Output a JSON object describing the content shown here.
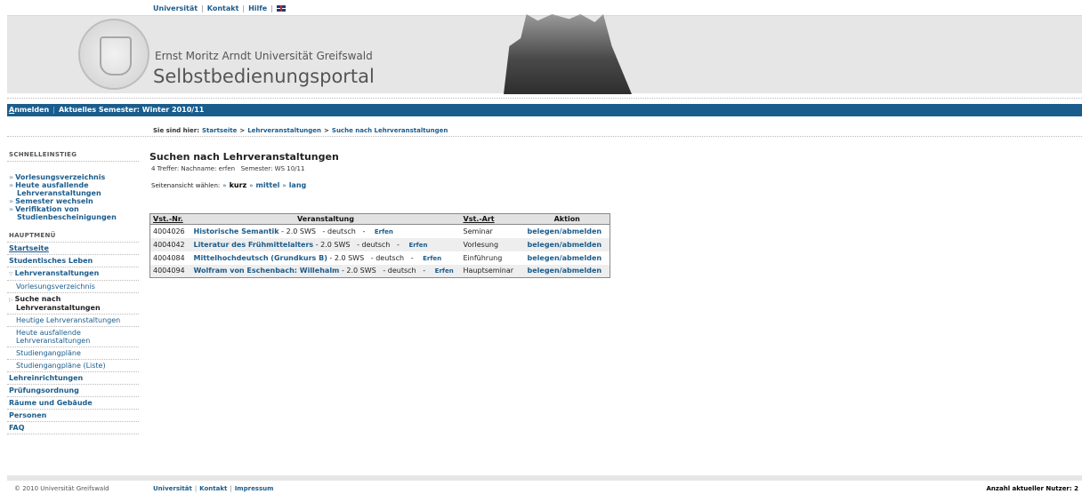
{
  "top_links": {
    "universitaet": "Universität",
    "kontakt": "Kontakt",
    "hilfe": "Hilfe"
  },
  "header": {
    "university": "Ernst Moritz Arndt Universität Greifswald",
    "portal": "Selbstbedienungsportal"
  },
  "navbar": {
    "login_first": "A",
    "login_rest": "nmelden",
    "semester": "Aktuelles Semester: Winter 2010/11"
  },
  "breadcrumb": {
    "prefix": "Sie sind hier:",
    "items": [
      "Startseite",
      "Lehrveranstaltungen",
      "Suche nach Lehrveranstaltungen"
    ],
    "sep": ">"
  },
  "sidebar": {
    "quick_title": "SCHNELLEINSTIEG",
    "quick": [
      {
        "line1": "Vorlesungsverzeichnis",
        "line2": ""
      },
      {
        "line1": "Heute ausfallende",
        "line2": "Lehrveranstaltungen"
      },
      {
        "line1": "Semester wechseln",
        "line2": ""
      },
      {
        "line1": "Verifikation von",
        "line2": "Studienbescheinigungen"
      }
    ],
    "main_title": "HAUPTMENÜ",
    "menu": {
      "startseite": "Startseite",
      "studentisches_leben": "Studentisches Leben",
      "lehrveranstaltungen": "Lehrveranstaltungen",
      "sub": [
        {
          "line1": "Vorlesungsverzeichnis",
          "line2": ""
        },
        {
          "line1": "Suche nach",
          "line2": "Lehrveranstaltungen"
        },
        {
          "line1": "Heutige Lehrveranstaltungen",
          "line2": ""
        },
        {
          "line1": "Heute ausfallende",
          "line2": "Lehrveranstaltungen"
        },
        {
          "line1": "Studiengangpläne",
          "line2": ""
        },
        {
          "line1": "Studiengangpläne (Liste)",
          "line2": ""
        }
      ],
      "lehreinrichtungen": "Lehreinrichtungen",
      "pruefungsordnung": "Prüfungsordnung",
      "raeume": "Räume und Gebäude",
      "personen": "Personen",
      "faq": "FAQ"
    }
  },
  "content": {
    "title": "Suchen nach Lehrveranstaltungen",
    "treffer": "4 Treffer: Nachname: erfen   Semester: WS 10/11",
    "view_label": "Seitenansicht wählen:",
    "view_kurz": "kurz",
    "view_mittel": "mittel",
    "view_lang": "lang",
    "table": {
      "headers": [
        "Vst.-Nr.",
        "Veranstaltung",
        "Vst.-Art",
        "Aktion"
      ],
      "rows": [
        {
          "nr": "4004026",
          "title": "Historische Semantik",
          "info": " - 2.0 SWS   - deutsch   - ",
          "person": "Erfen",
          "art": "Seminar",
          "action": "belegen/abmelden"
        },
        {
          "nr": "4004042",
          "title": "Literatur des Frühmittelalters",
          "info": " - 2.0 SWS   - deutsch   - ",
          "person": "Erfen",
          "art": "Vorlesung",
          "action": "belegen/abmelden"
        },
        {
          "nr": "4004084",
          "title": "Mittelhochdeutsch (Grundkurs B)",
          "info": " - 2.0 SWS   - deutsch   - ",
          "person": "Erfen",
          "art": "Einführung",
          "action": "belegen/abmelden"
        },
        {
          "nr": "4004094",
          "title": "Wolfram von Eschenbach: Willehalm",
          "info": " - 2.0 SWS   - deutsch   - ",
          "person": "Erfen",
          "art": "Hauptseminar",
          "action": "belegen/abmelden"
        }
      ]
    }
  },
  "footer": {
    "copyright": "© 2010 Universität Greifswald",
    "universitaet": "Universität",
    "kontakt": "Kontakt",
    "impressum": "Impressum",
    "users": "Anzahl aktueller Nutzer: 2"
  },
  "colors": {
    "nav_blue": "#1a5d8d",
    "link_blue": "#1b5c8c",
    "header_gray": "#e6e6e6"
  }
}
